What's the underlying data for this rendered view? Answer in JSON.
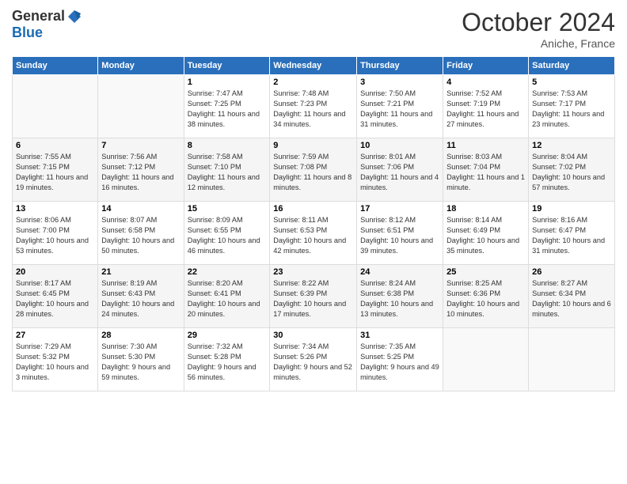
{
  "header": {
    "logo_general": "General",
    "logo_blue": "Blue",
    "month_title": "October 2024",
    "location": "Aniche, France"
  },
  "days_of_week": [
    "Sunday",
    "Monday",
    "Tuesday",
    "Wednesday",
    "Thursday",
    "Friday",
    "Saturday"
  ],
  "weeks": [
    [
      {
        "num": "",
        "info": ""
      },
      {
        "num": "",
        "info": ""
      },
      {
        "num": "1",
        "info": "Sunrise: 7:47 AM\nSunset: 7:25 PM\nDaylight: 11 hours and 38 minutes."
      },
      {
        "num": "2",
        "info": "Sunrise: 7:48 AM\nSunset: 7:23 PM\nDaylight: 11 hours and 34 minutes."
      },
      {
        "num": "3",
        "info": "Sunrise: 7:50 AM\nSunset: 7:21 PM\nDaylight: 11 hours and 31 minutes."
      },
      {
        "num": "4",
        "info": "Sunrise: 7:52 AM\nSunset: 7:19 PM\nDaylight: 11 hours and 27 minutes."
      },
      {
        "num": "5",
        "info": "Sunrise: 7:53 AM\nSunset: 7:17 PM\nDaylight: 11 hours and 23 minutes."
      }
    ],
    [
      {
        "num": "6",
        "info": "Sunrise: 7:55 AM\nSunset: 7:15 PM\nDaylight: 11 hours and 19 minutes."
      },
      {
        "num": "7",
        "info": "Sunrise: 7:56 AM\nSunset: 7:12 PM\nDaylight: 11 hours and 16 minutes."
      },
      {
        "num": "8",
        "info": "Sunrise: 7:58 AM\nSunset: 7:10 PM\nDaylight: 11 hours and 12 minutes."
      },
      {
        "num": "9",
        "info": "Sunrise: 7:59 AM\nSunset: 7:08 PM\nDaylight: 11 hours and 8 minutes."
      },
      {
        "num": "10",
        "info": "Sunrise: 8:01 AM\nSunset: 7:06 PM\nDaylight: 11 hours and 4 minutes."
      },
      {
        "num": "11",
        "info": "Sunrise: 8:03 AM\nSunset: 7:04 PM\nDaylight: 11 hours and 1 minute."
      },
      {
        "num": "12",
        "info": "Sunrise: 8:04 AM\nSunset: 7:02 PM\nDaylight: 10 hours and 57 minutes."
      }
    ],
    [
      {
        "num": "13",
        "info": "Sunrise: 8:06 AM\nSunset: 7:00 PM\nDaylight: 10 hours and 53 minutes."
      },
      {
        "num": "14",
        "info": "Sunrise: 8:07 AM\nSunset: 6:58 PM\nDaylight: 10 hours and 50 minutes."
      },
      {
        "num": "15",
        "info": "Sunrise: 8:09 AM\nSunset: 6:55 PM\nDaylight: 10 hours and 46 minutes."
      },
      {
        "num": "16",
        "info": "Sunrise: 8:11 AM\nSunset: 6:53 PM\nDaylight: 10 hours and 42 minutes."
      },
      {
        "num": "17",
        "info": "Sunrise: 8:12 AM\nSunset: 6:51 PM\nDaylight: 10 hours and 39 minutes."
      },
      {
        "num": "18",
        "info": "Sunrise: 8:14 AM\nSunset: 6:49 PM\nDaylight: 10 hours and 35 minutes."
      },
      {
        "num": "19",
        "info": "Sunrise: 8:16 AM\nSunset: 6:47 PM\nDaylight: 10 hours and 31 minutes."
      }
    ],
    [
      {
        "num": "20",
        "info": "Sunrise: 8:17 AM\nSunset: 6:45 PM\nDaylight: 10 hours and 28 minutes."
      },
      {
        "num": "21",
        "info": "Sunrise: 8:19 AM\nSunset: 6:43 PM\nDaylight: 10 hours and 24 minutes."
      },
      {
        "num": "22",
        "info": "Sunrise: 8:20 AM\nSunset: 6:41 PM\nDaylight: 10 hours and 20 minutes."
      },
      {
        "num": "23",
        "info": "Sunrise: 8:22 AM\nSunset: 6:39 PM\nDaylight: 10 hours and 17 minutes."
      },
      {
        "num": "24",
        "info": "Sunrise: 8:24 AM\nSunset: 6:38 PM\nDaylight: 10 hours and 13 minutes."
      },
      {
        "num": "25",
        "info": "Sunrise: 8:25 AM\nSunset: 6:36 PM\nDaylight: 10 hours and 10 minutes."
      },
      {
        "num": "26",
        "info": "Sunrise: 8:27 AM\nSunset: 6:34 PM\nDaylight: 10 hours and 6 minutes."
      }
    ],
    [
      {
        "num": "27",
        "info": "Sunrise: 7:29 AM\nSunset: 5:32 PM\nDaylight: 10 hours and 3 minutes."
      },
      {
        "num": "28",
        "info": "Sunrise: 7:30 AM\nSunset: 5:30 PM\nDaylight: 9 hours and 59 minutes."
      },
      {
        "num": "29",
        "info": "Sunrise: 7:32 AM\nSunset: 5:28 PM\nDaylight: 9 hours and 56 minutes."
      },
      {
        "num": "30",
        "info": "Sunrise: 7:34 AM\nSunset: 5:26 PM\nDaylight: 9 hours and 52 minutes."
      },
      {
        "num": "31",
        "info": "Sunrise: 7:35 AM\nSunset: 5:25 PM\nDaylight: 9 hours and 49 minutes."
      },
      {
        "num": "",
        "info": ""
      },
      {
        "num": "",
        "info": ""
      }
    ]
  ]
}
